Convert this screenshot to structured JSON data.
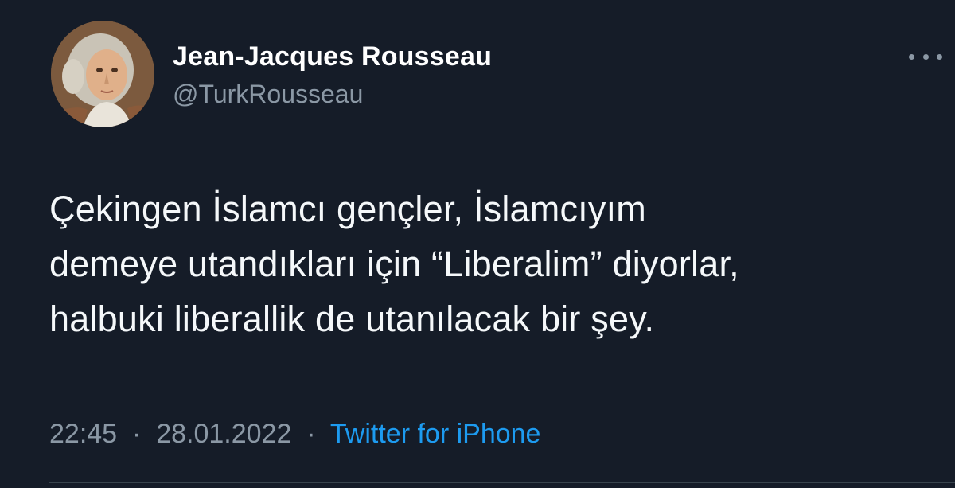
{
  "author": {
    "name": "Jean-Jacques Rousseau",
    "handle": "@TurkRousseau",
    "avatar_icon": "portrait-avatar"
  },
  "tweet": {
    "lines": [
      "Çekingen İslamcı gençler, İslamcıyım",
      "demeye utandıkları için “Liberalim” diyorlar,",
      "halbuki liberallik de utanılacak bir şey."
    ]
  },
  "meta": {
    "time": "22:45",
    "separator": "·",
    "date": "28.01.2022",
    "source": "Twitter for iPhone"
  },
  "colors": {
    "background": "#151c28",
    "secondary_text": "#8b98a5",
    "link": "#1d9bf0"
  },
  "more_icon": "more-horizontal-icon"
}
